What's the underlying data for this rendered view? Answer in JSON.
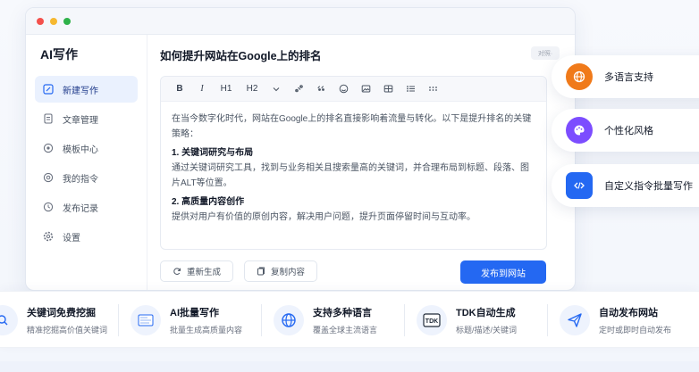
{
  "app": {
    "brand": "AI写作"
  },
  "sidebar": {
    "items": [
      {
        "label": "新建写作",
        "icon": "edit-icon",
        "active": true
      },
      {
        "label": "文章管理",
        "icon": "document-icon",
        "active": false
      },
      {
        "label": "模板中心",
        "icon": "template-icon",
        "active": false
      },
      {
        "label": "我的指令",
        "icon": "command-icon",
        "active": false
      },
      {
        "label": "发布记录",
        "icon": "history-icon",
        "active": false
      },
      {
        "label": "设置",
        "icon": "gear-icon",
        "active": false
      }
    ]
  },
  "document": {
    "title": "如何提升网站在Google上的排名",
    "badge": "对照·",
    "toolbar": {
      "bold": "B",
      "italic": "I",
      "h1": "H1",
      "h2": "H2"
    },
    "intro": "在当今数字化时代，网站在Google上的排名直接影响着流量与转化。以下是提升排名的关键策略：",
    "section1_heading": "1. 关键词研究与布局",
    "section1_body": "通过关键词研究工具，找到与业务相关且搜索量高的关键词，并合理布局到标题、段落、图片ALT等位置。",
    "section2_heading": "2. 高质量内容创作",
    "section2_body": "提供对用户有价值的原创内容，解决用户问题，提升页面停留时间与互动率。"
  },
  "actions": {
    "regenerate": "重新生成",
    "copy": "复制内容",
    "publish": "发布到网站"
  },
  "feature_cards": [
    {
      "label": "多语言支持",
      "icon": "globe-icon",
      "color": "#f07a1a"
    },
    {
      "label": "个性化风格",
      "icon": "palette-icon",
      "color": "#7c4dff"
    },
    {
      "label": "自定义指令批量写作",
      "icon": "code-icon",
      "color": "#2468f2"
    }
  ],
  "bottom_features": [
    {
      "title": "关键词免费挖掘",
      "desc": "精准挖掘高价值关键词",
      "icon": "keyword-icon"
    },
    {
      "title": "AI批量写作",
      "desc": "批量生成高质量内容",
      "icon": "batch-write-icon"
    },
    {
      "title": "支持多种语言",
      "desc": "覆盖全球主流语言",
      "icon": "globe-icon"
    },
    {
      "title": "TDK自动生成",
      "desc": "标题/描述/关键词",
      "icon": "tdk-icon"
    },
    {
      "title": "自动发布网站",
      "desc": "定时或即时自动发布",
      "icon": "send-icon"
    }
  ],
  "colors": {
    "accent": "#2468f2",
    "window_dots": [
      "#f4514c",
      "#f6b830",
      "#2fb24a"
    ]
  }
}
